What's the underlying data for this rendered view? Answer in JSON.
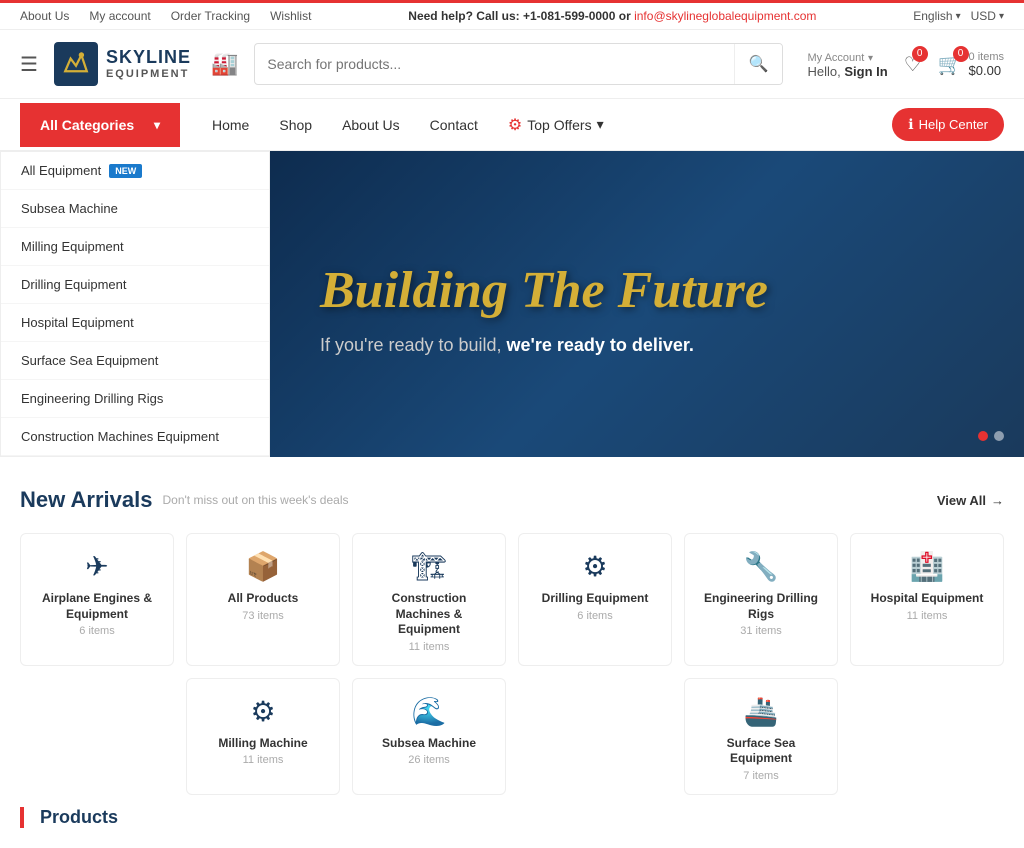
{
  "topAccent": true,
  "topBar": {
    "links": [
      {
        "label": "About Us",
        "href": "#"
      },
      {
        "label": "My account",
        "href": "#"
      },
      {
        "label": "Order Tracking",
        "href": "#"
      },
      {
        "label": "Wishlist",
        "href": "#"
      }
    ],
    "helpText": "Need help? Call us:",
    "phone": "+1-081-599-0000",
    "orText": " or ",
    "email": "info@skylineglobalequipment.com",
    "language": "English",
    "currency": "USD"
  },
  "header": {
    "brandName": "SKYLINE",
    "brandSub": "EQUIPMENT",
    "searchPlaceholder": "Search for products...",
    "myAccountLabel": "My Account",
    "helloLabel": "Hello,",
    "signInLabel": "Sign In",
    "wishlistBadge": "0",
    "cartBadge": "0",
    "cartItemsLabel": "0 items",
    "cartTotal": "$0.00"
  },
  "nav": {
    "allCategoriesLabel": "All Categories",
    "links": [
      {
        "label": "Home",
        "href": "#"
      },
      {
        "label": "Shop",
        "href": "#"
      },
      {
        "label": "About Us",
        "href": "#"
      },
      {
        "label": "Contact",
        "href": "#"
      }
    ],
    "topOffersLabel": "Top Offers",
    "helpCenterLabel": "Help Center"
  },
  "categories": [
    {
      "label": "All Equipment",
      "isNew": true
    },
    {
      "label": "Subsea Machine",
      "isNew": false
    },
    {
      "label": "Milling Equipment",
      "isNew": false
    },
    {
      "label": "Drilling Equipment",
      "isNew": false
    },
    {
      "label": "Hospital Equipment",
      "isNew": false
    },
    {
      "label": "Surface Sea Equipment",
      "isNew": false
    },
    {
      "label": "Engineering Drilling Rigs",
      "isNew": false
    },
    {
      "label": "Construction Machines Equipment",
      "isNew": false
    }
  ],
  "banner": {
    "title": "Building The Future",
    "subtitle": "If you're ready to build,",
    "subtitleBold": "we're ready to deliver.",
    "dots": [
      true,
      false
    ]
  },
  "newArrivals": {
    "title": "New Arrivals",
    "subtitle": "Don't miss out on this week's deals",
    "viewAllLabel": "View All",
    "categoryCards": [
      {
        "title": "Airplane Engines & Equipment",
        "count": "6 items",
        "icon": "✈"
      },
      {
        "title": "All Products",
        "count": "73 items",
        "icon": "📦"
      },
      {
        "title": "Construction Machines & Equipment",
        "count": "11 items",
        "icon": "🏗"
      },
      {
        "title": "Drilling Equipment",
        "count": "6 items",
        "icon": "⚙"
      },
      {
        "title": "Engineering Drilling Rigs",
        "count": "31 items",
        "icon": "🔧"
      },
      {
        "title": "Hospital Equipment",
        "count": "11 items",
        "icon": "🏥"
      },
      {
        "title": "Milling Machine",
        "count": "11 items",
        "icon": "⚙"
      },
      {
        "title": "Subsea Machine",
        "count": "26 items",
        "icon": "🌊"
      },
      {
        "title": "Surface Sea Equipment",
        "count": "7 items",
        "icon": "🚢"
      }
    ],
    "productsLabel": "Products"
  }
}
